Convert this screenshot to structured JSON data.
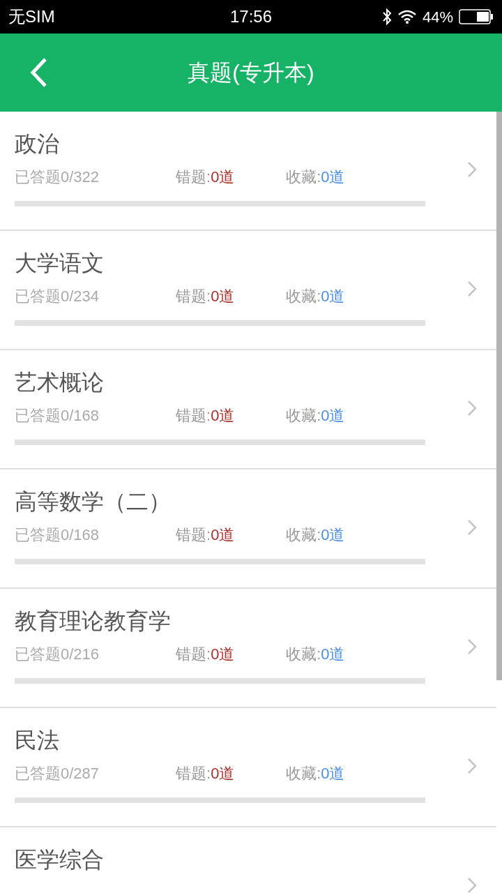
{
  "status_bar": {
    "carrier": "无SIM",
    "time": "17:56",
    "battery": "44%"
  },
  "header": {
    "title": "真题(专升本)"
  },
  "subjects": [
    {
      "title": "政治",
      "answered": "已答题0/322",
      "wrong_label": "错题:",
      "wrong_count": "0道",
      "fav_label": "收藏:",
      "fav_count": "0道",
      "level": 0
    },
    {
      "title": "大学语文",
      "answered": "已答题0/234",
      "wrong_label": "错题:",
      "wrong_count": "0道",
      "fav_label": "收藏:",
      "fav_count": "0道",
      "level": 0
    },
    {
      "title": "艺术概论",
      "answered": "已答题0/168",
      "wrong_label": "错题:",
      "wrong_count": "0道",
      "fav_label": "收藏:",
      "fav_count": "0道",
      "level": 0
    },
    {
      "title": "高等数学（二）",
      "answered": "已答题0/168",
      "wrong_label": "错题:",
      "wrong_count": "0道",
      "fav_label": "收藏:",
      "fav_count": "0道",
      "level": 0
    },
    {
      "title": "教育理论教育学",
      "answered": "已答题0/216",
      "wrong_label": "错题:",
      "wrong_count": "0道",
      "fav_label": "收藏:",
      "fav_count": "0道",
      "level": 0
    },
    {
      "title": "民法",
      "answered": "已答题0/287",
      "wrong_label": "错题:",
      "wrong_count": "0道",
      "fav_label": "收藏:",
      "fav_count": "0道",
      "level": 0
    },
    {
      "title": "医学综合"
    }
  ]
}
